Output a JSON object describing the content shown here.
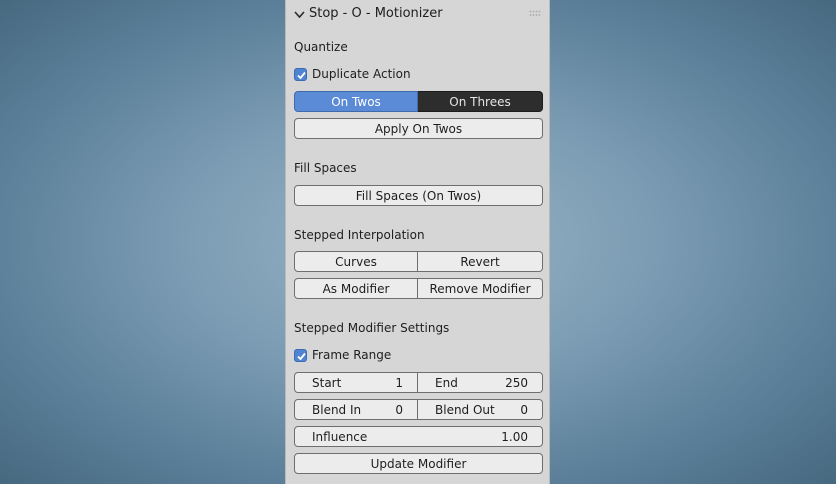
{
  "panel": {
    "title": "Stop - O - Motionizer"
  },
  "quantize": {
    "label": "Quantize",
    "duplicate_action": {
      "label": "Duplicate Action",
      "checked": true
    },
    "mode_options": [
      {
        "label": "On Twos",
        "active": true
      },
      {
        "label": "On Threes",
        "active": false
      }
    ],
    "apply_button": "Apply On Twos"
  },
  "fill_spaces": {
    "label": "Fill Spaces",
    "button": "Fill Spaces (On Twos)"
  },
  "stepped_interpolation": {
    "label": "Stepped Interpolation",
    "curves_button": "Curves",
    "revert_button": "Revert",
    "as_modifier_button": "As Modifier",
    "remove_modifier_button": "Remove Modifier"
  },
  "modifier_settings": {
    "label": "Stepped Modifier Settings",
    "frame_range": {
      "label": "Frame Range",
      "checked": true
    },
    "start": {
      "label": "Start",
      "value": "1"
    },
    "end": {
      "label": "End",
      "value": "250"
    },
    "blend_in": {
      "label": "Blend In",
      "value": "0"
    },
    "blend_out": {
      "label": "Blend Out",
      "value": "0"
    },
    "influence": {
      "label": "Influence",
      "value": "1.00"
    },
    "update_button": "Update Modifier"
  },
  "colors": {
    "accent": "#5b8bd6",
    "panel_bg": "#d6d6d6",
    "button_bg": "#ececec",
    "toggle_off_bg": "#2d2d2d"
  }
}
